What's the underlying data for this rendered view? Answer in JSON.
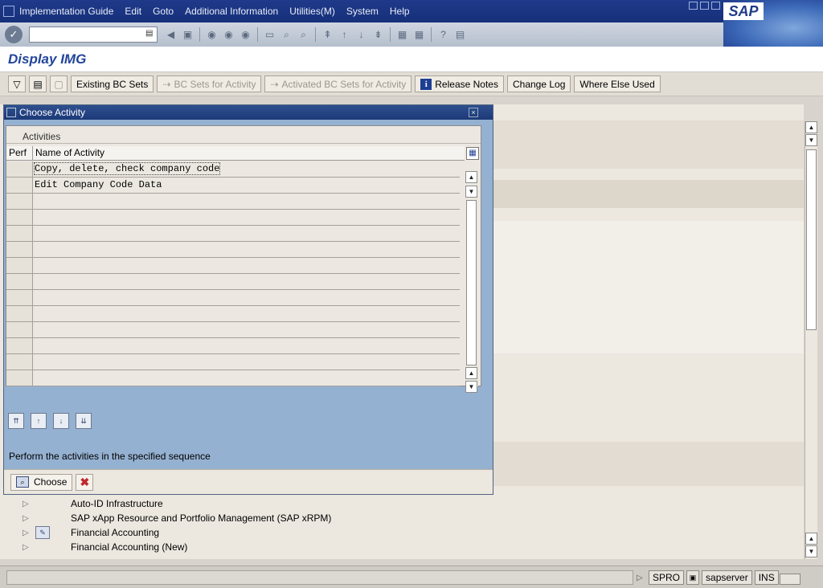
{
  "menubar": {
    "items": [
      "Implementation Guide",
      "Edit",
      "Goto",
      "Additional Information",
      "Utilities(M)",
      "System",
      "Help"
    ],
    "logo": "SAP"
  },
  "stdbar": {
    "command_value": ""
  },
  "title": "Display IMG",
  "appbar": {
    "existing_bc_sets": "Existing BC Sets",
    "bc_sets_for_activity": "BC Sets for Activity",
    "activated_bc_sets": "Activated BC Sets for Activity",
    "release_notes": "Release Notes",
    "change_log": "Change Log",
    "where_else_used": "Where Else Used"
  },
  "dialog": {
    "title": "Choose Activity",
    "caption": "Activities",
    "columns": [
      "Perf",
      "Name of Activity"
    ],
    "rows": [
      "Copy, delete, check company code",
      "Edit Company Code Data"
    ],
    "hint": "Perform the activities in the specified sequence",
    "choose_label": "Choose"
  },
  "tree": [
    "Auto-ID Infrastructure",
    "SAP xApp Resource and Portfolio Management (SAP xRPM)",
    "Financial Accounting",
    "Financial Accounting (New)"
  ],
  "statusbar": {
    "transaction": "SPRO",
    "server": "sapserver",
    "mode": "INS"
  }
}
